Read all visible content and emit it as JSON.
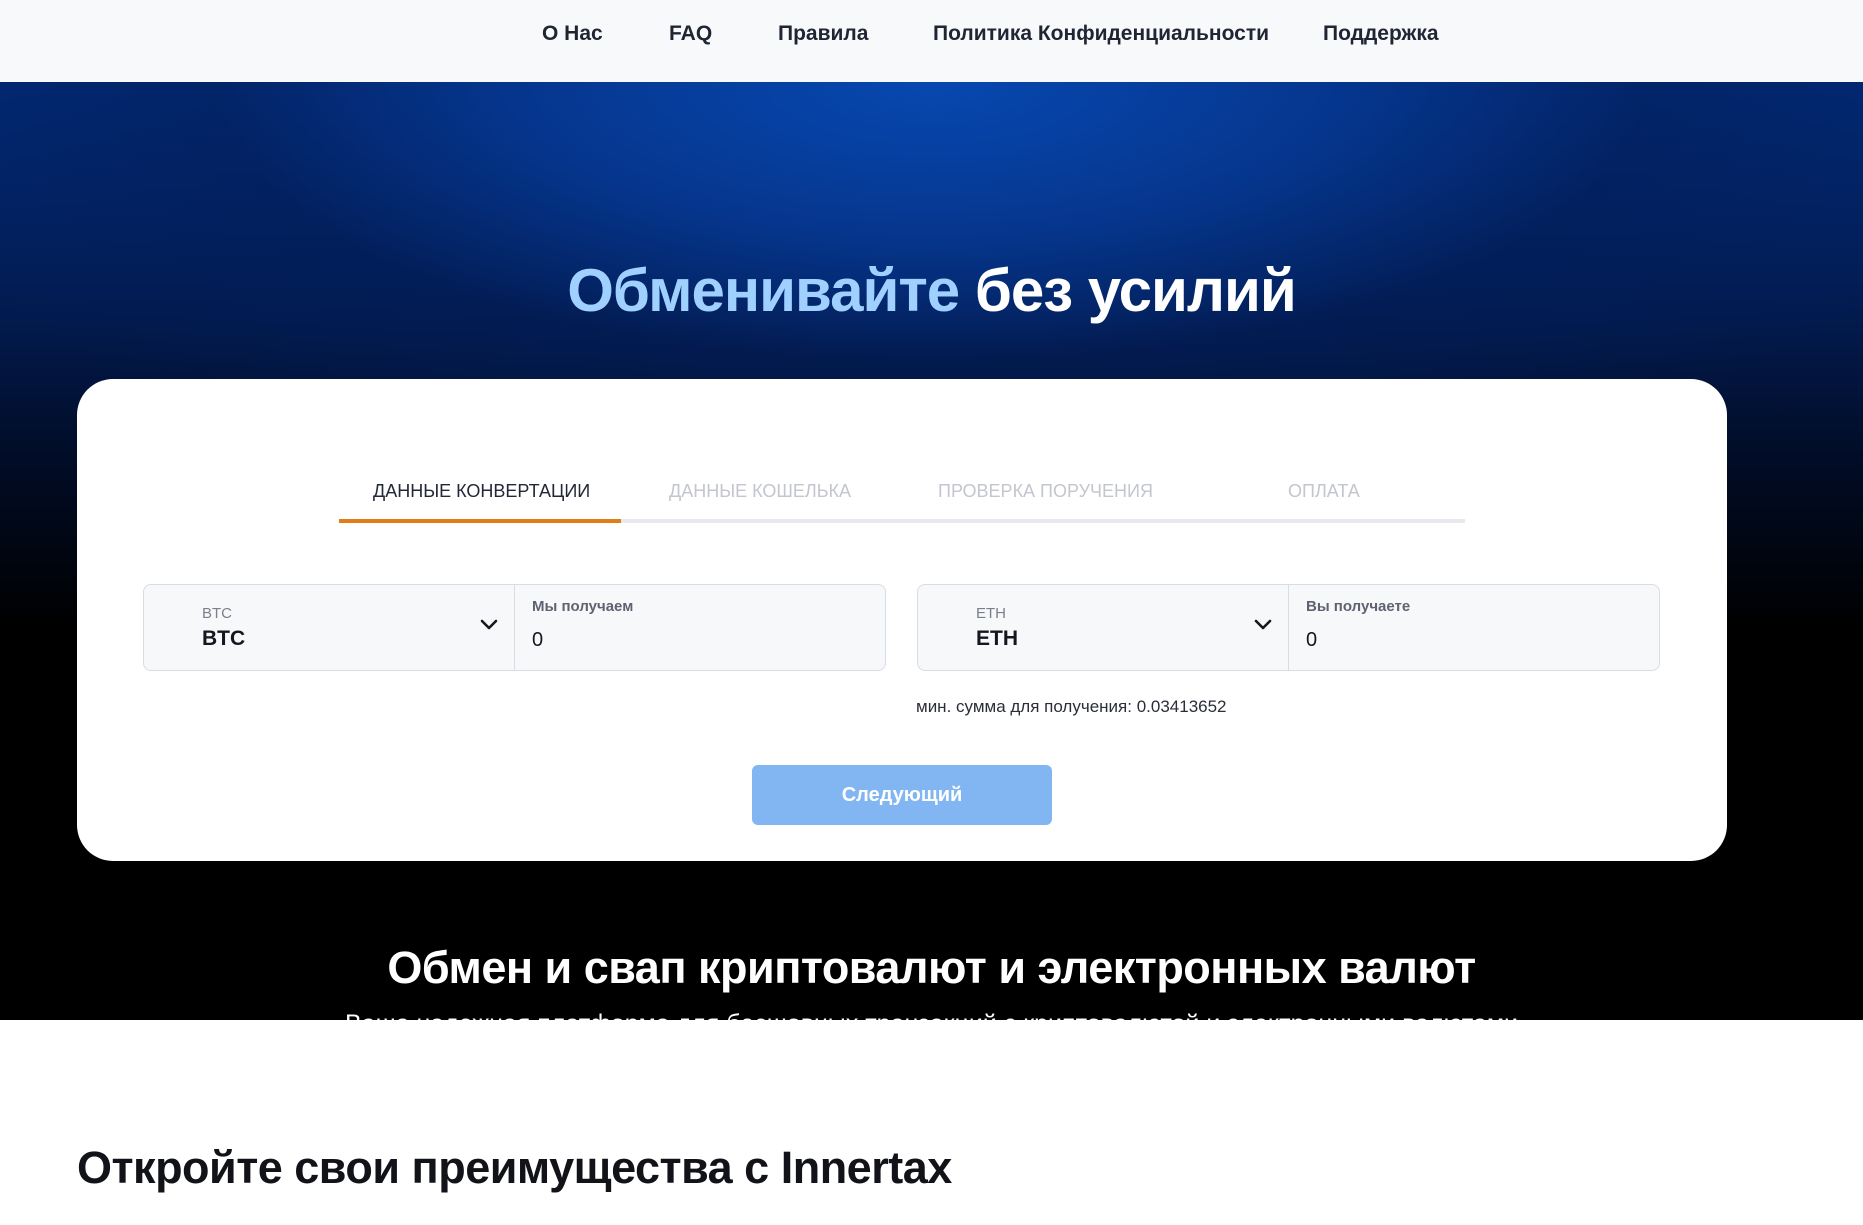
{
  "nav": {
    "items": [
      {
        "label": "О Нас"
      },
      {
        "label": "FAQ"
      },
      {
        "label": "Правила"
      },
      {
        "label": "Политика Конфиденциальности"
      },
      {
        "label": "Поддержка"
      }
    ]
  },
  "hero": {
    "title_accent": "Обменивайте",
    "title_rest": "без усилий"
  },
  "exchange": {
    "tabs": [
      {
        "label": "Данные конвертации",
        "active": true
      },
      {
        "label": "Данные кошелька",
        "active": false
      },
      {
        "label": "Проверка поручения",
        "active": false
      },
      {
        "label": "Оплата",
        "active": false
      }
    ],
    "from": {
      "currency_small": "BTC",
      "currency": "BTC",
      "amount_label": "Мы получаем",
      "amount_value": "0",
      "chevron_icon": "chevron-down-icon"
    },
    "to": {
      "currency_small": "ETH",
      "currency": "ETH",
      "amount_label": "Вы получаете",
      "amount_value": "0",
      "chevron_icon": "chevron-down-icon"
    },
    "min_amount_text": "мин. сумма для получения: 0.03413652",
    "next_button_label": "Следующий"
  },
  "section": {
    "title": "Обмен и свап криптовалют и электронных валют",
    "subtitle": "Ваша надежная платформа для бесшовных транзакций с криптовалютой и электронными валютами"
  },
  "benefits": {
    "title": "Откройте свои преимущества с Innertax"
  },
  "colors": {
    "accent_tab": "#e07d17",
    "button": "#82b6f3",
    "hero_accent_text": "#9fd0ff",
    "hero_blue": "#0748b0"
  }
}
